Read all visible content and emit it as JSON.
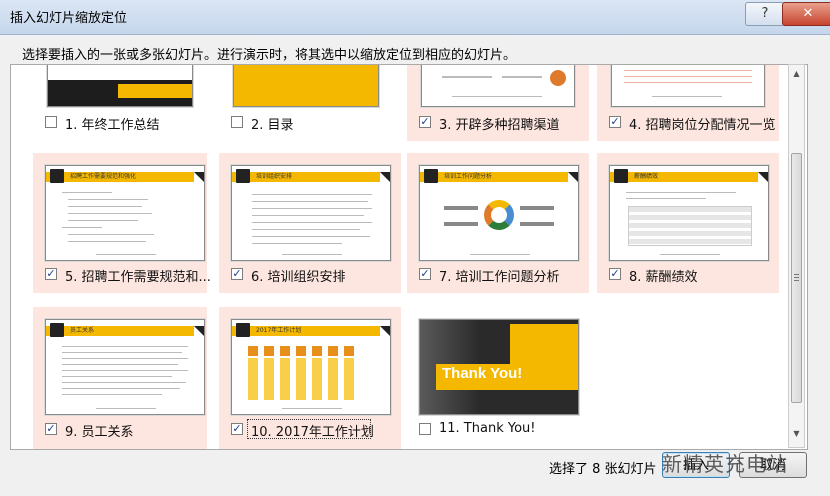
{
  "window": {
    "title": "插入幻灯片缩放定位",
    "help_label": "?",
    "close_label": "✕"
  },
  "instruction": "选择要插入的一张或多张幻灯片。进行演示时，将其选中以缩放定位到相应的幻灯片。",
  "slides": [
    {
      "label": "1. 年终工作总结",
      "checked": false,
      "kind": "cover"
    },
    {
      "label": "2. 目录",
      "checked": false,
      "kind": "toc"
    },
    {
      "label": "3. 开辟多种招聘渠道",
      "checked": true,
      "kind": "content"
    },
    {
      "label": "4. 招聘岗位分配情况一览",
      "checked": true,
      "kind": "table"
    },
    {
      "label": "5. 招聘工作需要规范和...",
      "checked": true,
      "kind": "content",
      "header": "招聘工作需要规范和强化"
    },
    {
      "label": "6. 培训组织安排",
      "checked": true,
      "kind": "content",
      "header": "培训组织安排"
    },
    {
      "label": "7. 培训工作问题分析",
      "checked": true,
      "kind": "diagram",
      "header": "培训工作问题分析"
    },
    {
      "label": "8. 薪酬绩效",
      "checked": true,
      "kind": "table",
      "header": "薪酬绩效"
    },
    {
      "label": "9. 员工关系",
      "checked": true,
      "kind": "content",
      "header": "员工关系"
    },
    {
      "label": "10. 2017年工作计划",
      "checked": true,
      "kind": "plan",
      "header": "2017年工作计划"
    },
    {
      "label": "11. Thank You!",
      "checked": false,
      "kind": "thanks",
      "thanks_text": "Thank You!"
    }
  ],
  "footer": {
    "status": "选择了 8 张幻灯片",
    "insert_label": "插入",
    "cancel_label": "取消"
  },
  "watermark": "新精英充电站",
  "colors": {
    "selected_bg": "#fde6df",
    "accent": "#f5b800"
  }
}
